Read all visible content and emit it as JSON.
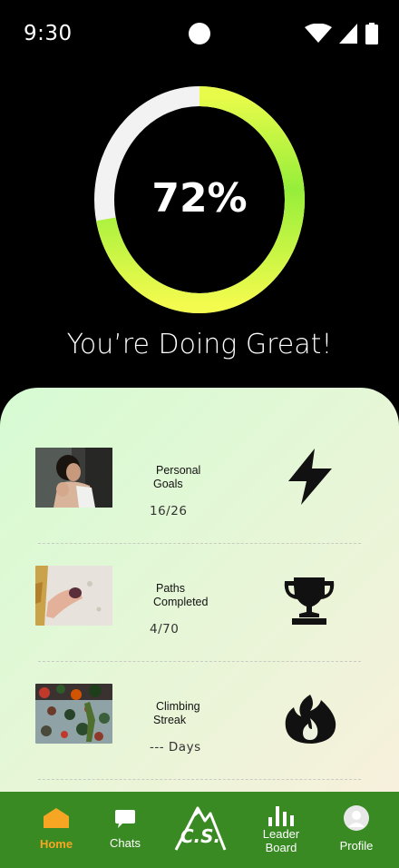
{
  "status_bar": {
    "time": "9:30"
  },
  "progress": {
    "percent_label": "72%",
    "value": 0.72
  },
  "headline": "You’re Doing Great!",
  "cards": [
    {
      "title_line1": "Personal",
      "title_line2": "Goals",
      "value": "16/26",
      "icon": "lightning-icon"
    },
    {
      "title_line1": "Paths",
      "title_line2": "Completed",
      "value": "4/70",
      "icon": "trophy-icon"
    },
    {
      "title_line1": "Climbing",
      "title_line2": "Streak",
      "value": "--- Days",
      "icon": "fire-icon"
    }
  ],
  "nav": {
    "home": "Home",
    "chats": "Chats",
    "logo": "C.S.",
    "leaderboard_line1": "Leader",
    "leaderboard_line2": "Board",
    "profile": "Profile"
  },
  "colors": {
    "nav_bg": "#3a8a24",
    "active": "#f6a623",
    "ring_track": "#f2f2f2",
    "ring_start": "#e8fb4a",
    "ring_end": "#92ef3a"
  }
}
